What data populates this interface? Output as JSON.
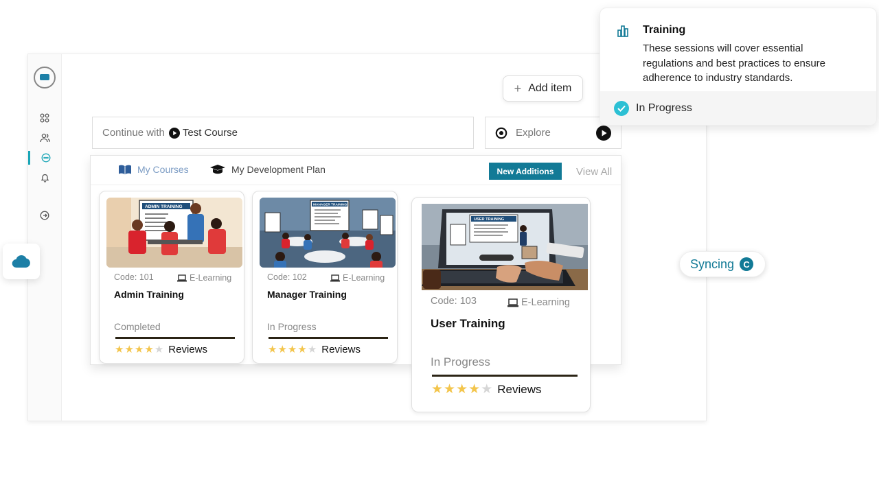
{
  "header": {
    "add_item_label": "Add item"
  },
  "continue_bar": {
    "prefix": "Continue with",
    "course": "Test Course"
  },
  "explore": {
    "label": "Explore"
  },
  "tabs": [
    {
      "label": "My Courses",
      "icon": "book-open-icon",
      "active": true
    },
    {
      "label": "My Development Plan",
      "icon": "graduation-cap-icon",
      "active": false
    }
  ],
  "new_additions_label": "New Additions",
  "view_all_label": "View All",
  "courses": [
    {
      "code": "Code: 101",
      "type": "E-Learning",
      "title": "Admin Training",
      "status": "Completed",
      "rating": 4,
      "reviews_label": "Reviews",
      "banner": "ADMIN TRAINING"
    },
    {
      "code": "Code: 102",
      "type": "E-Learning",
      "title": "Manager Training",
      "status": "In Progress",
      "rating": 4,
      "reviews_label": "Reviews",
      "banner": "MANAGER TRAINING"
    },
    {
      "code": "Code: 103",
      "type": "E-Learning",
      "title": "User Training",
      "status": "In Progress",
      "rating": 4,
      "reviews_label": "Reviews",
      "banner": "USER TRAINING"
    }
  ],
  "sync": {
    "label": "Syncing"
  },
  "popup": {
    "title": "Training",
    "body": "These sessions will cover essential regulations and best practices to ensure adherence to industry standards.",
    "status": "In Progress"
  },
  "colors": {
    "accent": "#127a96",
    "teal": "#1aa6b7",
    "star": "#f3c54c"
  }
}
